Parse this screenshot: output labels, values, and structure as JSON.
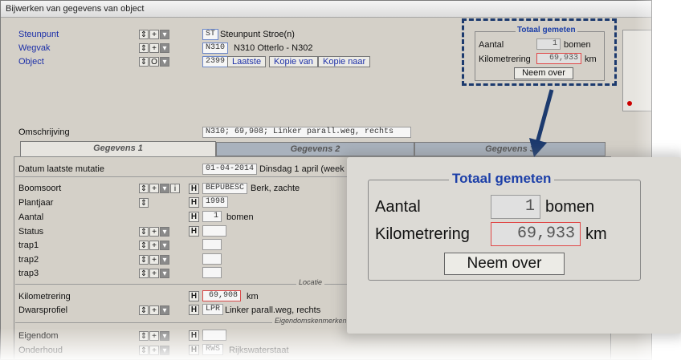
{
  "window": {
    "title": "Bijwerken van gegevens van object"
  },
  "header": {
    "steunpunt": {
      "label": "Steunpunt",
      "code": "ST",
      "value": "Steunpunt Stroe(n)"
    },
    "wegvak": {
      "label": "Wegvak",
      "code": "N310",
      "value": "N310 Otterlo - N302"
    },
    "object": {
      "label": "Object",
      "code": "2399",
      "circle_icon": "O",
      "buttons": [
        "Laatste",
        "Kopie van",
        "Kopie naar"
      ]
    }
  },
  "omschrijving": {
    "label": "Omschrijving",
    "value": "N310; 69,908; Linker parall.weg, rechts"
  },
  "tabs": [
    "Gegevens 1",
    "Gegevens 2",
    "Gegevens 3"
  ],
  "datum": {
    "label": "Datum laatste mutatie",
    "value": "01-04-2014",
    "suffix": "Dinsdag  1 april (week 1"
  },
  "fields": {
    "boomsoort": {
      "label": "Boomsoort",
      "code": "BEPUBESC",
      "value": "Berk, zachte"
    },
    "plantjaar": {
      "label": "Plantjaar",
      "value": "1998"
    },
    "aantal": {
      "label": "Aantal",
      "value": "1",
      "unit": "bomen"
    },
    "status": {
      "label": "Status"
    },
    "trap1": {
      "label": "trap1"
    },
    "trap2": {
      "label": "trap2"
    },
    "trap3": {
      "label": "trap3"
    },
    "kilometrering": {
      "label": "Kilometrering",
      "value": "69,908",
      "unit": "km"
    },
    "dwarsprofiel": {
      "label": "Dwarsprofiel",
      "code": "LPR",
      "value": "Linker parall.weg, rechts"
    },
    "eigendom": {
      "label": "Eigendom"
    },
    "onderhoud": {
      "label": "Onderhoud",
      "code": "RWS",
      "value": "Rijkswaterstaat"
    }
  },
  "sections": {
    "locatie": "Locatie",
    "eigendom": "Eigendomskenmerken"
  },
  "icons": {
    "h": "H",
    "info": "i",
    "plus": "+"
  },
  "totaal": {
    "title": "Totaal gemeten",
    "aantal_label": "Aantal",
    "aantal": "1",
    "aantal_unit": "bomen",
    "km_label": "Kilometrering",
    "km": "69,933",
    "km_unit": "km",
    "button": "Neem over"
  },
  "colors": {
    "accent": "#1c3fa8",
    "highlight_border": "#1c3a6e",
    "error_border": "#e04848"
  }
}
